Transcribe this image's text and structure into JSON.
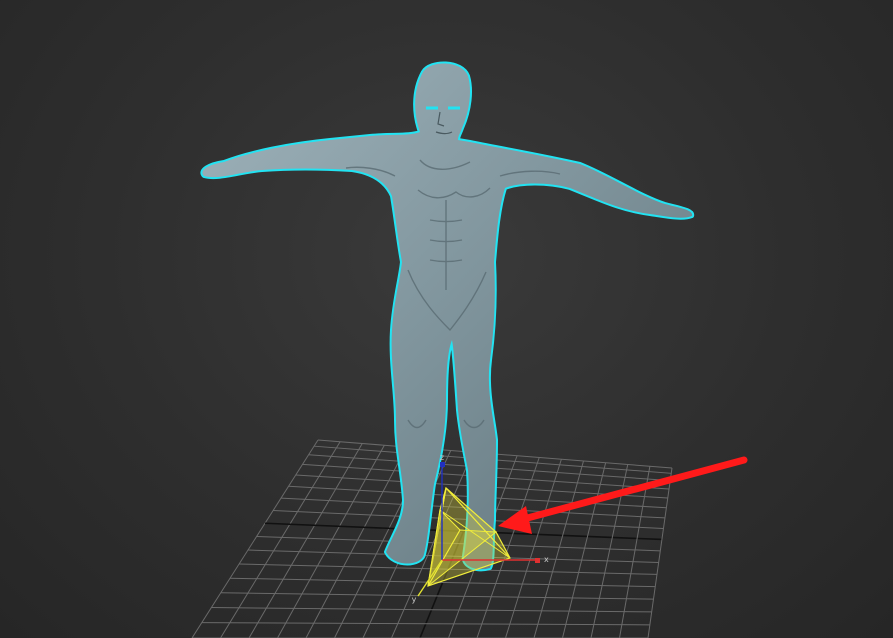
{
  "viewport": {
    "axes": {
      "x": "x",
      "y": "y",
      "z": "z"
    },
    "colors": {
      "background": "#2e2e2e",
      "grid": "#6a6a6a",
      "grid_axis": "#111111",
      "model": "#8a9ea7",
      "selection_outline": "#22e3f2",
      "gizmo": "#f2ee3a",
      "annotation_arrow": "#ff1a1a",
      "axis_x": "#e03030",
      "axis_y": "#e0e030",
      "axis_z": "#2030c0"
    },
    "objects": {
      "model": "human-figure-t-pose",
      "gizmo": "light-cone-gizmo",
      "annotation": "red-arrow"
    }
  }
}
